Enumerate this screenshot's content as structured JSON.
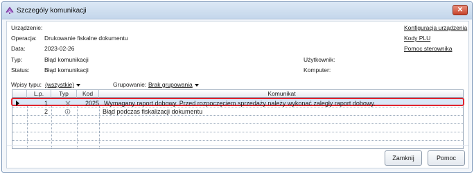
{
  "window": {
    "title": "Szczegóły komunikacji"
  },
  "details": {
    "device_label": "Urządzenie:",
    "operation_label": "Operacja:",
    "operation_value": "Drukowanie fiskalne dokumentu",
    "date_label": "Data:",
    "date_value": "2023-02-26",
    "type_label": "Typ:",
    "type_value": "Błąd komunikacji",
    "status_label": "Status:",
    "status_value": "Błąd komunikacji",
    "user_label": "Użytkownik:",
    "computer_label": "Komputer:"
  },
  "links": {
    "device_config": "Konfiguracja urządzenia",
    "plu_codes": "Kody PLU",
    "driver_help": "Pomoc sterownika"
  },
  "filters": {
    "entry_types_label": "Wpisy typu:",
    "entry_types_value": "(wszystkie)",
    "grouping_label": "Grupowanie:",
    "grouping_value": "Brak grupowania"
  },
  "grid": {
    "columns": [
      "L.p.",
      "Typ",
      "Kod",
      "Komunikat"
    ],
    "rows": [
      {
        "lp": "1",
        "type_icon": "error-x-icon",
        "code": "2025",
        "message": "Wymagany raport dobowy. Przed rozpoczęciem sprzedaży należy wykonać zaległy raport dobowy."
      },
      {
        "lp": "2",
        "type_icon": "info-icon",
        "code": "",
        "message": "Błąd podczas fiskalizacji dokumentu"
      }
    ]
  },
  "buttons": {
    "close": "Zamknij",
    "help": "Pomoc"
  },
  "colors": {
    "selection_border": "#e0242e",
    "selection_fill": "#d9e7f7",
    "titlebar": "#c4d6eb"
  }
}
